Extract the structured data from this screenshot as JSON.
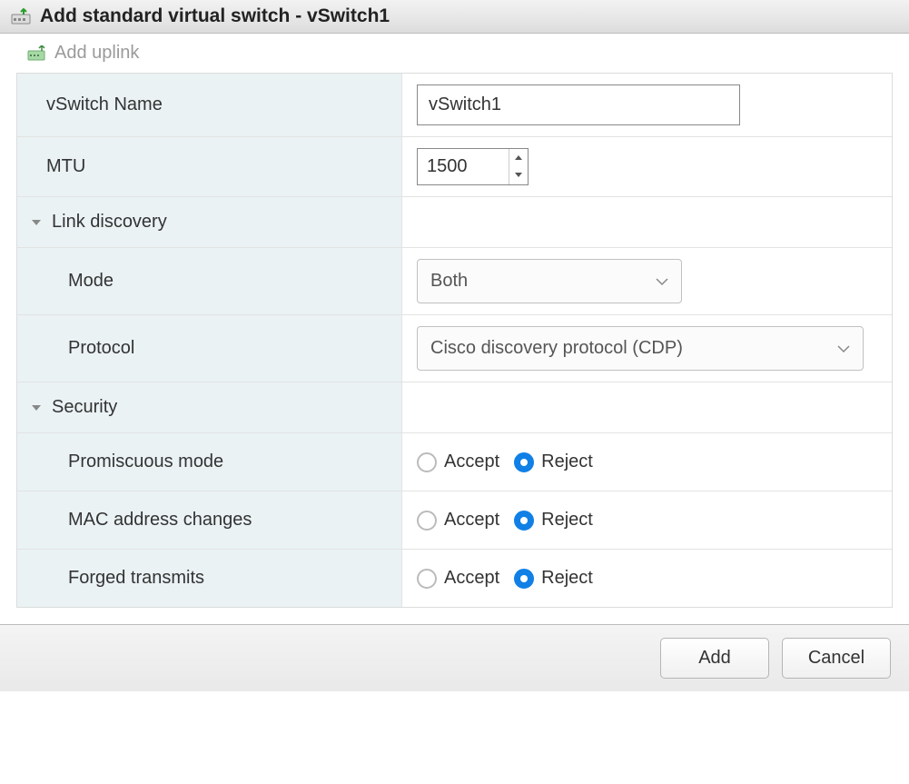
{
  "title": "Add standard virtual switch - vSwitch1",
  "toolbar": {
    "add_uplink": "Add uplink"
  },
  "labels": {
    "vswitch_name": "vSwitch Name",
    "mtu": "MTU",
    "link_discovery": "Link discovery",
    "mode": "Mode",
    "protocol": "Protocol",
    "security": "Security",
    "promiscuous_mode": "Promiscuous mode",
    "mac_address_changes": "MAC address changes",
    "forged_transmits": "Forged transmits"
  },
  "values": {
    "vswitch_name": "vSwitch1",
    "mtu": "1500",
    "mode": "Both",
    "protocol": "Cisco discovery protocol (CDP)"
  },
  "radio": {
    "accept": "Accept",
    "reject": "Reject",
    "promiscuous_selected": "reject",
    "mac_selected": "reject",
    "forged_selected": "reject"
  },
  "buttons": {
    "add": "Add",
    "cancel": "Cancel"
  }
}
